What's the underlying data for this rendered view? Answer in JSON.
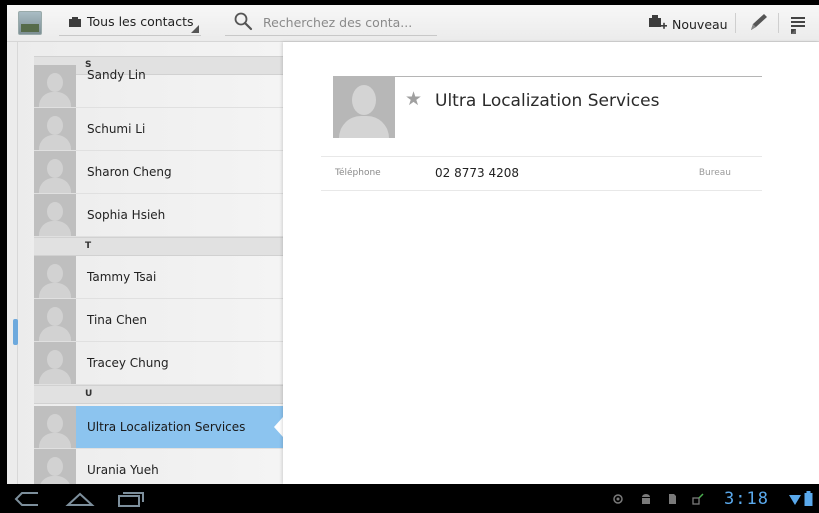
{
  "actionbar": {
    "filter_label": "Tous les contacts",
    "search_placeholder": "Recherchez des conta...",
    "new_label": "Nouveau"
  },
  "list": {
    "sections": [
      {
        "letter": "S",
        "contacts": [
          "Sandy Lin",
          "Schumi Li",
          "Sharon Cheng",
          "Sophia Hsieh"
        ]
      },
      {
        "letter": "T",
        "contacts": [
          "Tammy Tsai",
          "Tina Chen",
          "Tracey Chung"
        ]
      },
      {
        "letter": "U",
        "contacts": [
          "Ultra Localization Services",
          "Urania Yueh"
        ]
      }
    ],
    "selected": "Ultra Localization Services"
  },
  "detail": {
    "name": "Ultra Localization Services",
    "phone_label": "Téléphone",
    "phone_value": "02 8773 4208",
    "phone_type": "Bureau"
  },
  "statusbar": {
    "time": "3:18"
  },
  "colors": {
    "accent": "#8cc4ef",
    "clock": "#5aa9ec"
  }
}
